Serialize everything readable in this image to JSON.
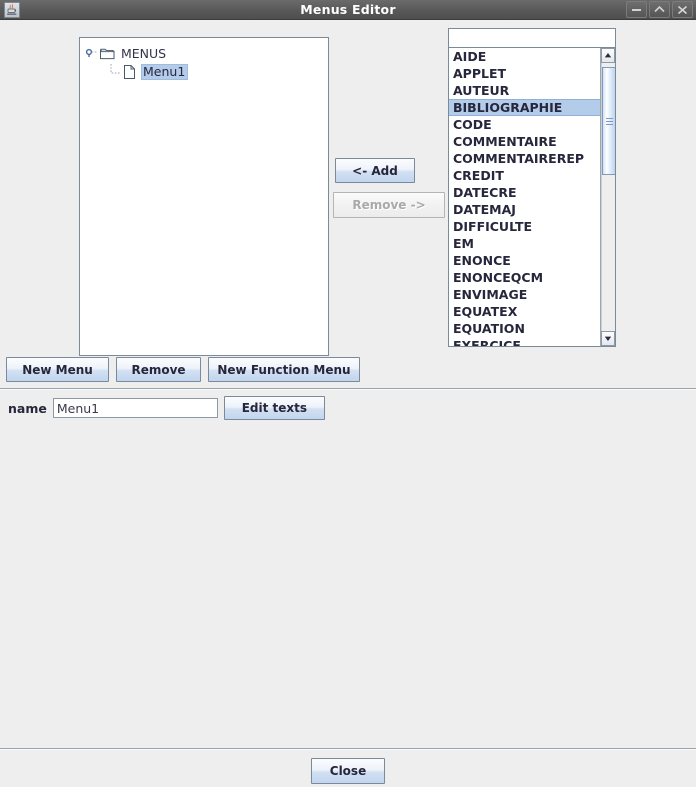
{
  "window": {
    "title": "Menus Editor",
    "app_icon": "java-coffee-cup-icon",
    "controls": {
      "minimize": "minimize-icon",
      "maximize": "maximize-icon",
      "close": "close-icon"
    }
  },
  "tree": {
    "root": {
      "label": "MENUS",
      "icon": "folder-icon",
      "expanded": true
    },
    "children": [
      {
        "label": "Menu1",
        "icon": "document-icon",
        "selected": true
      }
    ]
  },
  "transfer_buttons": {
    "add_label": "<- Add",
    "remove_label": "Remove ->",
    "add_enabled": true,
    "remove_enabled": false
  },
  "filter": {
    "value": "",
    "placeholder": ""
  },
  "list": {
    "items": [
      "AIDE",
      "APPLET",
      "AUTEUR",
      "BIBLIOGRAPHIE",
      "CODE",
      "COMMENTAIRE",
      "COMMENTAIREREP",
      "CREDIT",
      "DATECRE",
      "DATEMAJ",
      "DIFFICULTE",
      "EM",
      "ENONCE",
      "ENONCEQCM",
      "ENVIMAGE",
      "EQUATEX",
      "EQUATION",
      "EXERCICE"
    ],
    "selected_index": 3,
    "scrollbar": {
      "up_icon": "scroll-up-arrow-icon",
      "down_icon": "scroll-down-arrow-icon"
    }
  },
  "actions": {
    "new_menu_label": "New Menu",
    "remove_label": "Remove",
    "new_function_menu_label": "New Function Menu"
  },
  "form": {
    "name_label": "name",
    "name_value": "Menu1",
    "name_placeholder": "",
    "edit_texts_label": "Edit texts"
  },
  "footer": {
    "close_label": "Close"
  },
  "colors": {
    "selection": "#b3ccea",
    "titlebar": "#5a5a5a",
    "surface": "#eeeeee",
    "border": "#7a8a99"
  }
}
